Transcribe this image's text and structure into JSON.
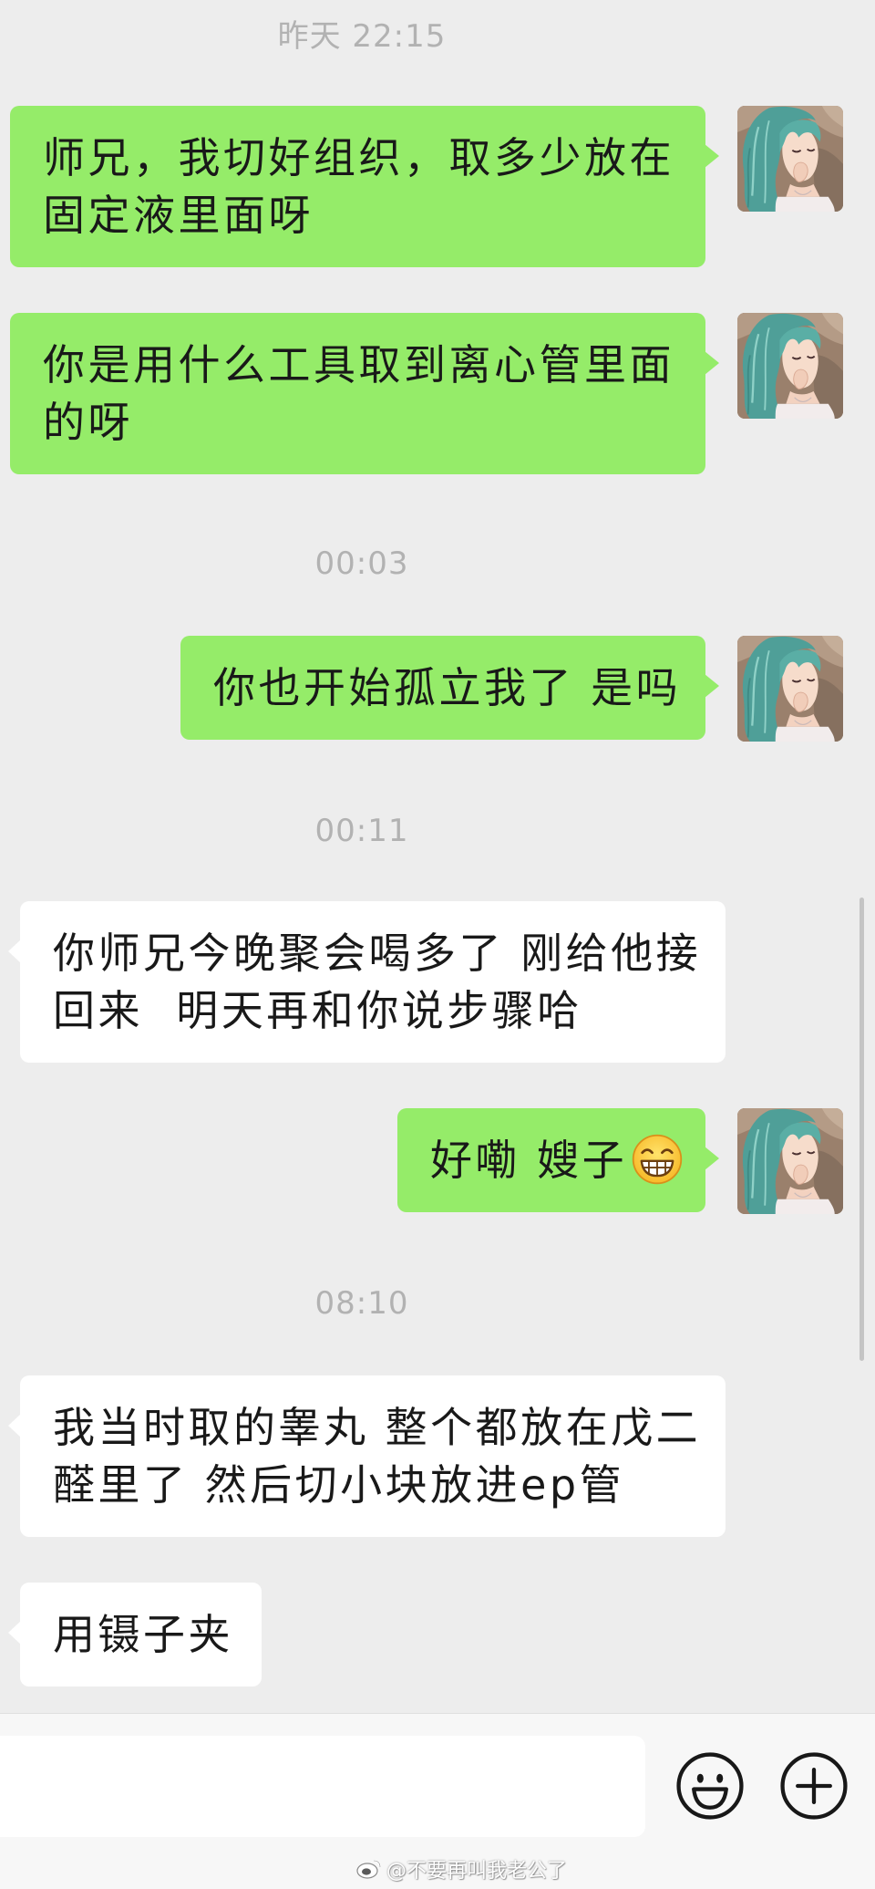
{
  "colors": {
    "background": "#ededed",
    "sent_bubble": "#95ec69",
    "received_bubble": "#ffffff",
    "timestamp_text": "#b2b2b2",
    "message_text": "#191919",
    "input_bar": "#f7f7f7"
  },
  "chat": {
    "groups": [
      {
        "time": "昨天 22:15",
        "messages": [
          {
            "text": "师兄，我切好组织，取多少放在\n固定液里面呀"
          },
          {
            "text": "你是用什么工具取到离心管里面\n的呀"
          }
        ]
      },
      {
        "time": "00:03",
        "messages": [
          {
            "text": "你也开始孤立我了 是吗"
          }
        ]
      },
      {
        "time": "00:11",
        "messages": [
          {
            "text": "你师兄今晚聚会喝多了 刚给他接\n回来  明天再和你说步骤哈"
          },
          {
            "text": "好嘞 嫂子",
            "emoji": "grinning-face-icon"
          }
        ]
      },
      {
        "time": "08:10",
        "messages": [
          {
            "text": "我当时取的睾丸 整个都放在戊二\n醛里了 然后切小块放进ep管"
          },
          {
            "text": "用镊子夹"
          }
        ]
      }
    ]
  },
  "input_bar": {
    "value": "",
    "placeholder": "",
    "emoji_button_icon": "smiley-face-icon",
    "more_button_icon": "plus-circle-icon"
  },
  "watermark": {
    "icon": "weibo-logo-icon",
    "text": "@不要再叫我老公了"
  }
}
